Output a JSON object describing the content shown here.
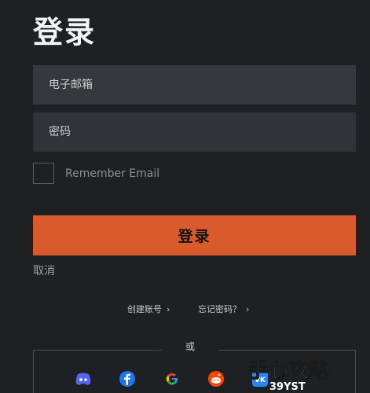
{
  "login": {
    "title": "登录",
    "email_placeholder": "电子邮箱",
    "password_placeholder": "密码",
    "remember_label": "Remember Email",
    "login_button": "登录",
    "cancel_label": "取消",
    "create_account": "创建账号",
    "forgot_password": "忘记密码？",
    "or_label": "或"
  },
  "social": {
    "providers": [
      "discord-icon",
      "facebook-icon",
      "google-icon",
      "reddit-icon",
      "vk-icon"
    ]
  },
  "colors": {
    "background": "#1e2124",
    "input": "#35383c",
    "accent": "#d95a2a"
  },
  "watermark": {
    "text": "手心攻略",
    "subtext": "39YST"
  }
}
